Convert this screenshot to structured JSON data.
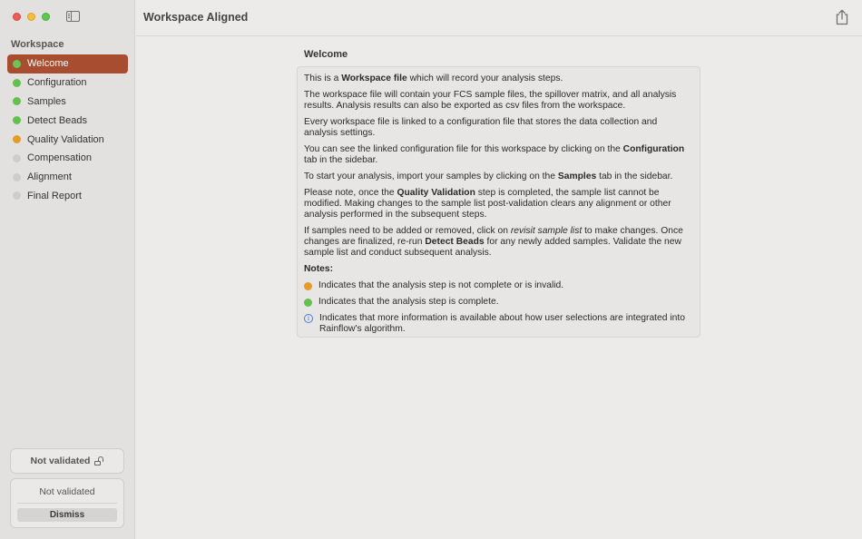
{
  "window": {
    "title": "Workspace Aligned"
  },
  "sidebar": {
    "section_label": "Workspace",
    "items": [
      {
        "label": "Welcome",
        "status": "complete",
        "active": true
      },
      {
        "label": "Configuration",
        "status": "complete"
      },
      {
        "label": "Samples",
        "status": "complete"
      },
      {
        "label": "Detect Beads",
        "status": "complete"
      },
      {
        "label": "Quality Validation",
        "status": "incomplete"
      },
      {
        "label": "Compensation",
        "status": "pending"
      },
      {
        "label": "Alignment",
        "status": "pending"
      },
      {
        "label": "Final Report",
        "status": "pending"
      }
    ],
    "validation_button": "Not validated",
    "status_text": "Not validated",
    "dismiss_label": "Dismiss"
  },
  "main": {
    "heading": "Welcome",
    "p1": {
      "a": "This is a ",
      "b": "Workspace file",
      "c": " which will record your analysis steps."
    },
    "p2": "The workspace file will contain your FCS sample files, the spillover matrix, and all analysis results. Analysis results can also be exported as csv files from the workspace.",
    "p3": "Every workspace file is linked to a configuration file that stores the data collection and analysis settings.",
    "p4": {
      "a": "You can see the linked configuration file for this workspace by clicking on the ",
      "b": "Configuration",
      "c": " tab in the sidebar."
    },
    "p5": {
      "a": "To start your analysis, import your samples by clicking on the ",
      "b": "Samples",
      "c": " tab in the sidebar."
    },
    "p6": {
      "a": "Please note, once the ",
      "b": "Quality Validation",
      "c": " step is completed, the sample list cannot be modified. Making changes to the sample list post-validation clears any alignment or other analysis performed in the subsequent steps."
    },
    "p7": {
      "a": "If samples need to be added or removed, click on ",
      "i": "revisit sample list",
      "b": " to make changes. Once changes are finalized, re-run ",
      "c": "Detect Beads",
      "d": " for any newly added samples. Validate the new sample list and conduct subsequent analysis."
    },
    "notes_title": "Notes:",
    "notes": [
      {
        "icon": "orange-dot",
        "text": "Indicates that the analysis step is not complete or is invalid."
      },
      {
        "icon": "green-dot",
        "text": "Indicates that the analysis step is complete."
      },
      {
        "icon": "info-icon",
        "text": "Indicates that more information is available about how user selections are integrated into Rainflow's algorithm."
      }
    ]
  },
  "colors": {
    "accent": "#a84d30",
    "complete": "#62c04d",
    "incomplete": "#e59a2a",
    "pending": "#cfcdcb",
    "info": "#4b7bd6"
  }
}
